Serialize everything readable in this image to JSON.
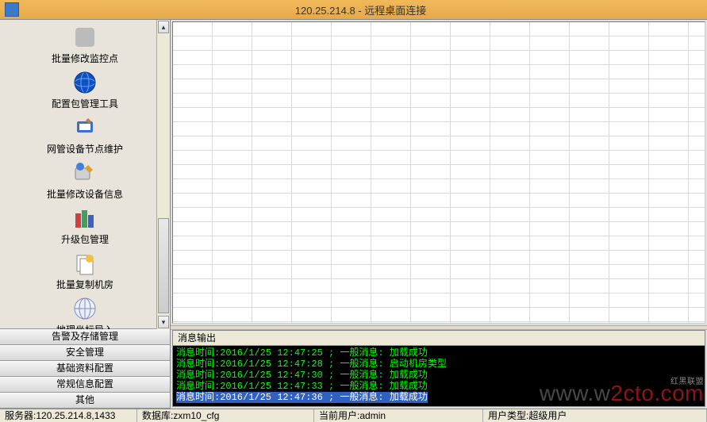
{
  "window": {
    "title": "120.25.214.8 - 远程桌面连接"
  },
  "sidebar": {
    "tools": [
      {
        "label": "批量修改监控点",
        "icon": "monitor-batch"
      },
      {
        "label": "配置包管理工具",
        "icon": "globe"
      },
      {
        "label": "网管设备节点维护",
        "icon": "wrench"
      },
      {
        "label": "批量修改设备信息",
        "icon": "device-edit"
      },
      {
        "label": "升级包管理",
        "icon": "buildings"
      },
      {
        "label": "批量复制机房",
        "icon": "copy-room"
      },
      {
        "label": "地理坐标导入",
        "icon": "globe2"
      },
      {
        "label": "",
        "icon": "user-key"
      }
    ],
    "panels": [
      "告警及存储管理",
      "安全管理",
      "基础资料配置",
      "常规信息配置",
      "其他"
    ]
  },
  "console": {
    "title": "消息输出",
    "lines": [
      {
        "text": "消息时间:2016/1/25 12:47:25 ;  一般消息: 加载成功",
        "style": "green"
      },
      {
        "text": "消息时间:2016/1/25 12:47:28 ;  一般消息: 启动机房类型",
        "style": "green"
      },
      {
        "text": "消息时间:2016/1/25 12:47:30 ;  一般消息: 加载成功",
        "style": "green"
      },
      {
        "text": "消息时间:2016/1/25 12:47:33 ;  一般消息: 加载成功",
        "style": "green"
      },
      {
        "text": "消息时间:2016/1/25 12:47:36 ;  一般消息: 加载成功",
        "style": "selected"
      }
    ]
  },
  "status": {
    "server_label": "服务器:",
    "server_value": "120.25.214.8,1433",
    "db_label": "数据库:",
    "db_value": "zxm10_cfg",
    "user_label": "当前用户:",
    "user_value": "admin",
    "type_label": "用户类型:",
    "type_value": "超级用户"
  },
  "watermark": {
    "prefix": "www.w",
    "mid": "2cto",
    "suffix": ".com",
    "tag": "红黑联盟"
  }
}
